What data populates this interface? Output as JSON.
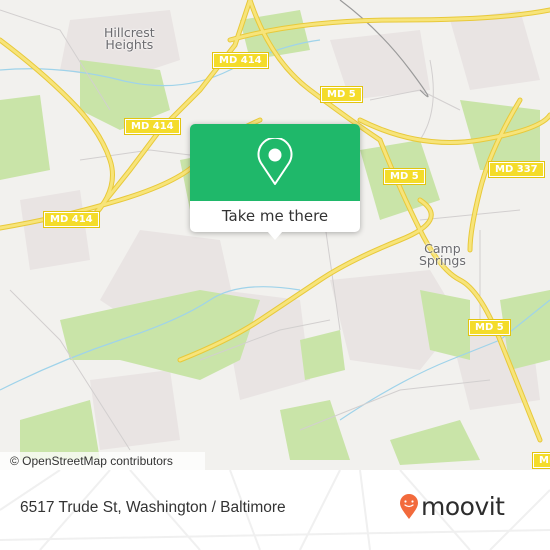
{
  "map": {
    "places": [
      {
        "name": "hillcrest-heights",
        "label": "Hillcrest\nHeights"
      },
      {
        "name": "camp-springs",
        "label": "Camp\nSprings"
      }
    ],
    "road_shields": [
      {
        "label": "MD 414"
      },
      {
        "label": "MD 414"
      },
      {
        "label": "MD 414"
      },
      {
        "label": "MD 5"
      },
      {
        "label": "MD 5"
      },
      {
        "label": "MD 337"
      },
      {
        "label": "MD 5"
      },
      {
        "label": "MD"
      }
    ],
    "colors": {
      "land": "#f2f1ee",
      "park": "#c8e6a6",
      "residential": "#e8e2e2",
      "major_road": "#f4dc5a",
      "water": "#9fd3ea",
      "minor_road": "#ffffff"
    },
    "attribution": "© OpenStreetMap contributors"
  },
  "popup": {
    "icon": "map-pin-icon",
    "button_label": "Take me there",
    "accent_color": "#1fb86a"
  },
  "footer": {
    "address": "6517 Trude St, Washington / Baltimore",
    "brand": "moovit",
    "brand_color": "#f26a3c"
  }
}
